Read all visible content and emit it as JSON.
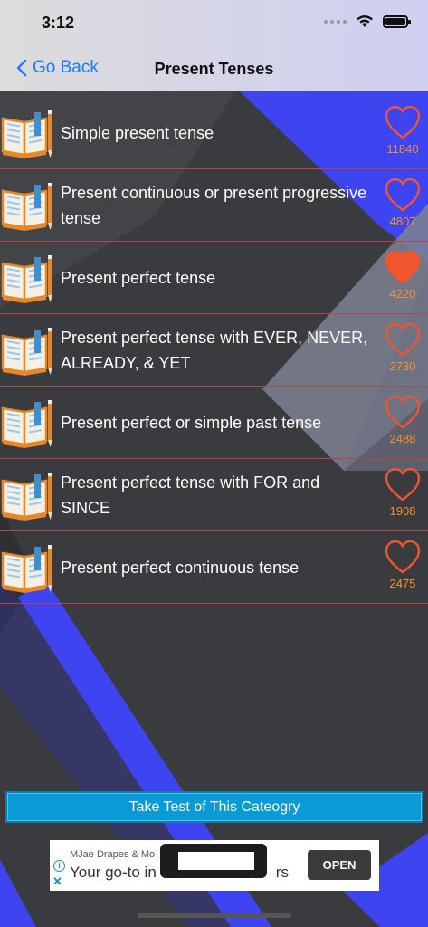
{
  "status_bar": {
    "time": "3:12"
  },
  "nav": {
    "back_label": "Go Back",
    "title": "Present Tenses"
  },
  "colors": {
    "accent_blue": "#1a7bff",
    "heart": "#f0552e",
    "count": "#f0952e",
    "divider": "#b8434a",
    "button": "#0a9bd6"
  },
  "topics": [
    {
      "label": "Simple present tense",
      "likes": "11840",
      "liked": false
    },
    {
      "label": "Present continuous or present progressive tense",
      "likes": "4807",
      "liked": false
    },
    {
      "label": "Present perfect tense",
      "likes": "4220",
      "liked": true
    },
    {
      "label": "Present perfect tense with EVER, NEVER, ALREADY, & YET",
      "likes": "2730",
      "liked": false
    },
    {
      "label": "Present perfect or simple past tense",
      "likes": "2488",
      "liked": false
    },
    {
      "label": "Present perfect tense with FOR and SINCE",
      "likes": "1908",
      "liked": false
    },
    {
      "label": "Present perfect continuous tense",
      "likes": "2475",
      "liked": false
    }
  ],
  "test_button": {
    "label": "Take Test of This Cateogry"
  },
  "ad": {
    "brand": "MJae Drapes & Mo",
    "headline": "Your go-to in",
    "headline_tail": "rs",
    "cta": "OPEN"
  }
}
